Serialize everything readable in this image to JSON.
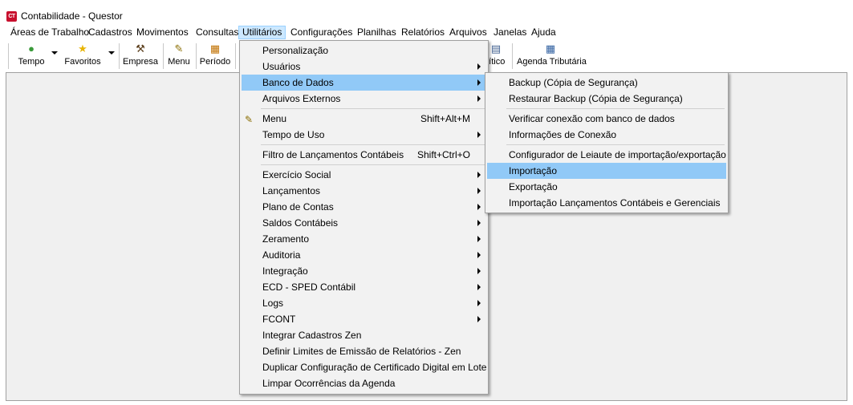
{
  "window": {
    "title": "Contabilidade - Questor",
    "icon_text": "CT"
  },
  "menubar": [
    {
      "label": "Áreas de Trabalho"
    },
    {
      "label": "Cadastros"
    },
    {
      "label": "Movimentos"
    },
    {
      "label": "Consultas"
    },
    {
      "label": "Utilitários"
    },
    {
      "label": "Configurações"
    },
    {
      "label": "Planilhas"
    },
    {
      "label": "Relatórios"
    },
    {
      "label": "Arquivos"
    },
    {
      "label": "Janelas"
    },
    {
      "label": "Ajuda"
    }
  ],
  "toolbar": {
    "tempo": "Tempo",
    "favoritos": "Favoritos",
    "empresa": "Empresa",
    "menu": "Menu",
    "periodo": "Período",
    "analitico_partial": "lítico",
    "agenda": "Agenda Tributária"
  },
  "utilitarios_menu": [
    {
      "label": "Personalização"
    },
    {
      "label": "Usuários"
    },
    {
      "label": "Banco de Dados"
    },
    {
      "label": "Arquivos Externos"
    },
    {
      "label": "Menu",
      "shortcut": "Shift+Alt+M"
    },
    {
      "label": "Tempo de Uso"
    },
    {
      "label": "Filtro de Lançamentos Contábeis",
      "shortcut": "Shift+Ctrl+O"
    },
    {
      "label": "Exercício Social"
    },
    {
      "label": "Lançamentos"
    },
    {
      "label": "Plano de Contas"
    },
    {
      "label": "Saldos Contábeis"
    },
    {
      "label": "Zeramento"
    },
    {
      "label": "Auditoria"
    },
    {
      "label": "Integração"
    },
    {
      "label": "ECD - SPED Contábil"
    },
    {
      "label": "Logs"
    },
    {
      "label": "FCONT"
    },
    {
      "label": "Integrar Cadastros Zen"
    },
    {
      "label": "Definir Limites de Emissão de Relatórios - Zen"
    },
    {
      "label": "Duplicar Configuração de Certificado Digital em Lote"
    },
    {
      "label": "Limpar Ocorrências da Agenda"
    }
  ],
  "banco_menu": [
    {
      "label": "Backup (Cópia de Segurança)"
    },
    {
      "label": "Restaurar Backup (Cópia de Segurança)"
    },
    {
      "label": "Verificar conexão com banco de dados"
    },
    {
      "label": "Informações de Conexão"
    },
    {
      "label": "Configurador de Leiaute de importação/exportação"
    },
    {
      "label": "Importação"
    },
    {
      "label": "Exportação"
    },
    {
      "label": "Importação Lançamentos Contábeis e Gerenciais"
    }
  ],
  "colors": {
    "menu_highlight": "#91c9f7",
    "menubar_active": "#cce8ff",
    "workspace": "#f0f0f0"
  }
}
